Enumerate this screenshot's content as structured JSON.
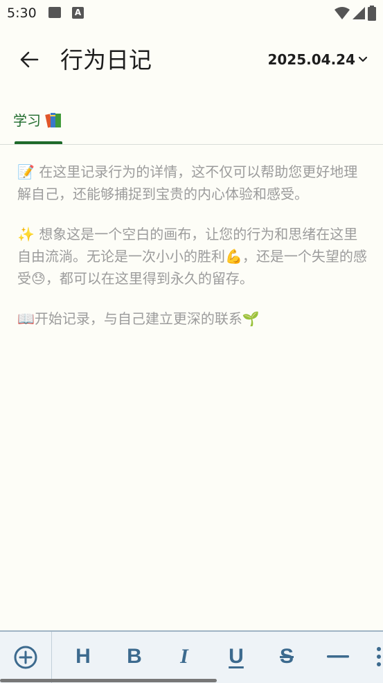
{
  "status_bar": {
    "time": "5:30",
    "icons": [
      "image-icon",
      "text-a-icon",
      "wifi-icon",
      "signal-icon",
      "battery-icon"
    ]
  },
  "app_bar": {
    "title": "行为日记",
    "date": "2025.04.24"
  },
  "tabs": [
    {
      "label": "学习",
      "icon": "books-icon",
      "active": true
    }
  ],
  "content": {
    "paragraphs": [
      "📝 在这里记录行为的详情，这不仅可以帮助您更好地理解自己，还能够捕捉到宝贵的内心体验和感受。",
      "✨ 想象这是一个空白的画布，让您的行为和思绪在这里自由流淌。无论是一次小小的胜利💪，还是一个失望的感受😓，都可以在这里得到永久的留存。",
      "📖开始记录，与自己建立更深的联系🌱"
    ]
  },
  "toolbar": {
    "heading_label": "H",
    "bold_label": "B",
    "italic_label": "I",
    "underline_label": "U",
    "strike_label": "S"
  },
  "colors": {
    "background": "#fdfdf7",
    "accent_green": "#1e6a2a",
    "toolbar_bg": "#eef3f7",
    "toolbar_icon": "#3c6a8e",
    "placeholder_text": "#9c9c9c"
  }
}
